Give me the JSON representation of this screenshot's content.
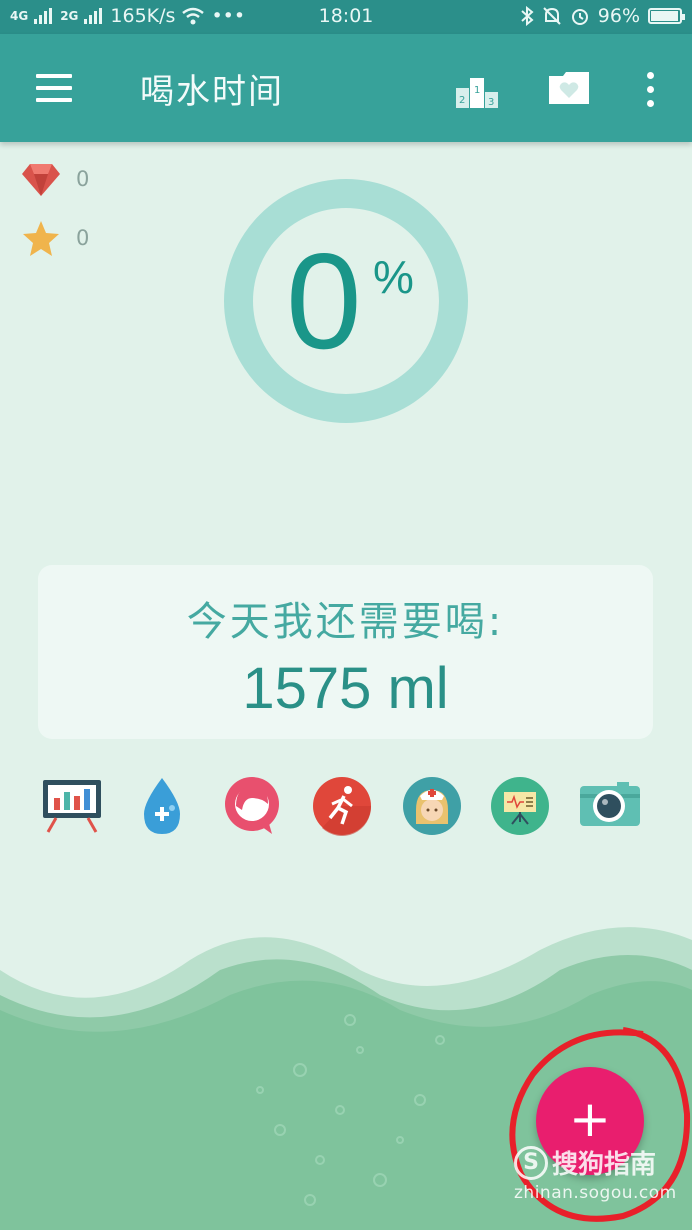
{
  "status_bar": {
    "signal_1": "4G",
    "signal_2": "2G",
    "speed": "165K/s",
    "dots": "•••",
    "time": "18:01",
    "battery": "96%"
  },
  "app_bar": {
    "title": "喝水时间",
    "icons": [
      "menu-icon",
      "podium-icon",
      "folder-heart-icon",
      "more-vert-icon"
    ]
  },
  "counters": {
    "gems": "0",
    "stars": "0"
  },
  "progress": {
    "value": "0",
    "unit": "%",
    "fraction": 0
  },
  "remaining": {
    "label": "今天我还需要喝:",
    "amount": "1575 ml"
  },
  "feature_icons": [
    "chart-board-icon",
    "water-drop-plus-icon",
    "profile-head-icon",
    "runner-icon",
    "nurse-icon",
    "presentation-icon",
    "camera-icon"
  ],
  "fab": {
    "symbol": "+"
  },
  "watermark": {
    "logo": "S",
    "brand": "搜狗指南",
    "url": "zhinan.sogou.com"
  },
  "colors": {
    "status_bar": "#2b8f8a",
    "app_bar": "#37a29a",
    "background": "#e1f2ea",
    "ring": "#a8ded5",
    "accent_text": "#1a9689",
    "fab": "#e91e6e",
    "water": "#7fc39c"
  }
}
